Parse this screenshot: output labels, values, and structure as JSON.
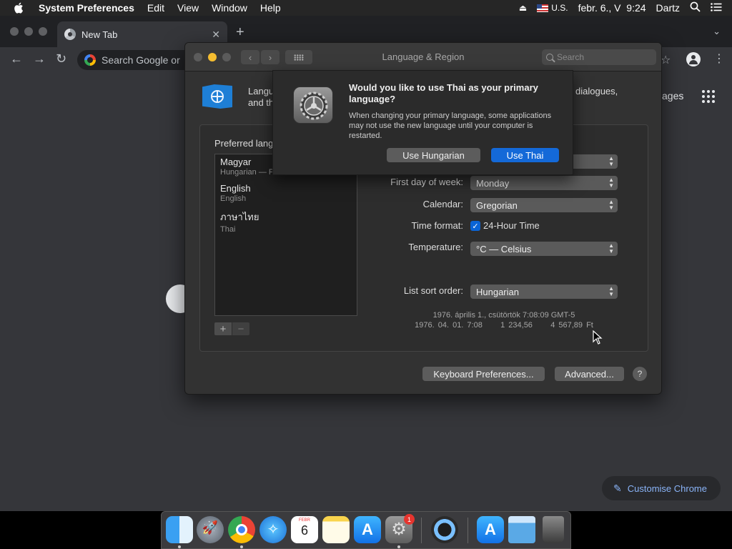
{
  "menubar": {
    "app_name": "System Preferences",
    "menus": [
      "Edit",
      "View",
      "Window",
      "Help"
    ],
    "input_source": "U.S.",
    "datetime": "febr. 6., V  9:24",
    "user": "Dartz"
  },
  "chrome": {
    "tab_title": "New Tab",
    "omnibox_placeholder": "Search Google or",
    "images_link": "ages",
    "customise_label": "Customise Chrome",
    "accent_color": "#8ab4f8"
  },
  "prefs": {
    "title": "Language & Region",
    "search_placeholder": "Search",
    "intro_line1_left": "Langu",
    "intro_line2_left": "and th",
    "intro_right": "dialogues,",
    "preferred_languages_label": "Preferred lang",
    "languages": [
      {
        "name": "Magyar",
        "sub": "Hungarian — P"
      },
      {
        "name": "English",
        "sub": "English"
      },
      {
        "name": "ภาษาไทย",
        "sub": "Thai"
      }
    ],
    "add_label": "+",
    "remove_label": "−",
    "first_day_label": "First day of week:",
    "first_day_value": "Monday",
    "calendar_label": "Calendar:",
    "calendar_value": "Gregorian",
    "time_format_label": "Time format:",
    "time_format_check": "24-Hour Time",
    "temperature_label": "Temperature:",
    "temperature_value": "°C — Celsius",
    "sort_order_label": "List sort order:",
    "sort_order_value": "Hungarian",
    "sample_line1": "1976. április 1., csütörtök 7:08:09 GMT-5",
    "sample_line2": "1976. 04. 01. 7:08     1 234,56     4 567,89 Ft",
    "keyboard_prefs_label": "Keyboard Preferences...",
    "advanced_label": "Advanced...",
    "help_label": "?"
  },
  "sheet": {
    "title": "Would you like to use Thai as your primary language?",
    "message": "When changing your primary language, some applications may not use the new language until your computer is restarted.",
    "secondary_button": "Use Hungarian",
    "primary_button": "Use Thai",
    "primary_color": "#1469d8"
  },
  "dock": {
    "calendar_month": "FEBR",
    "calendar_day": "6",
    "sysprefs_badge": "1"
  }
}
